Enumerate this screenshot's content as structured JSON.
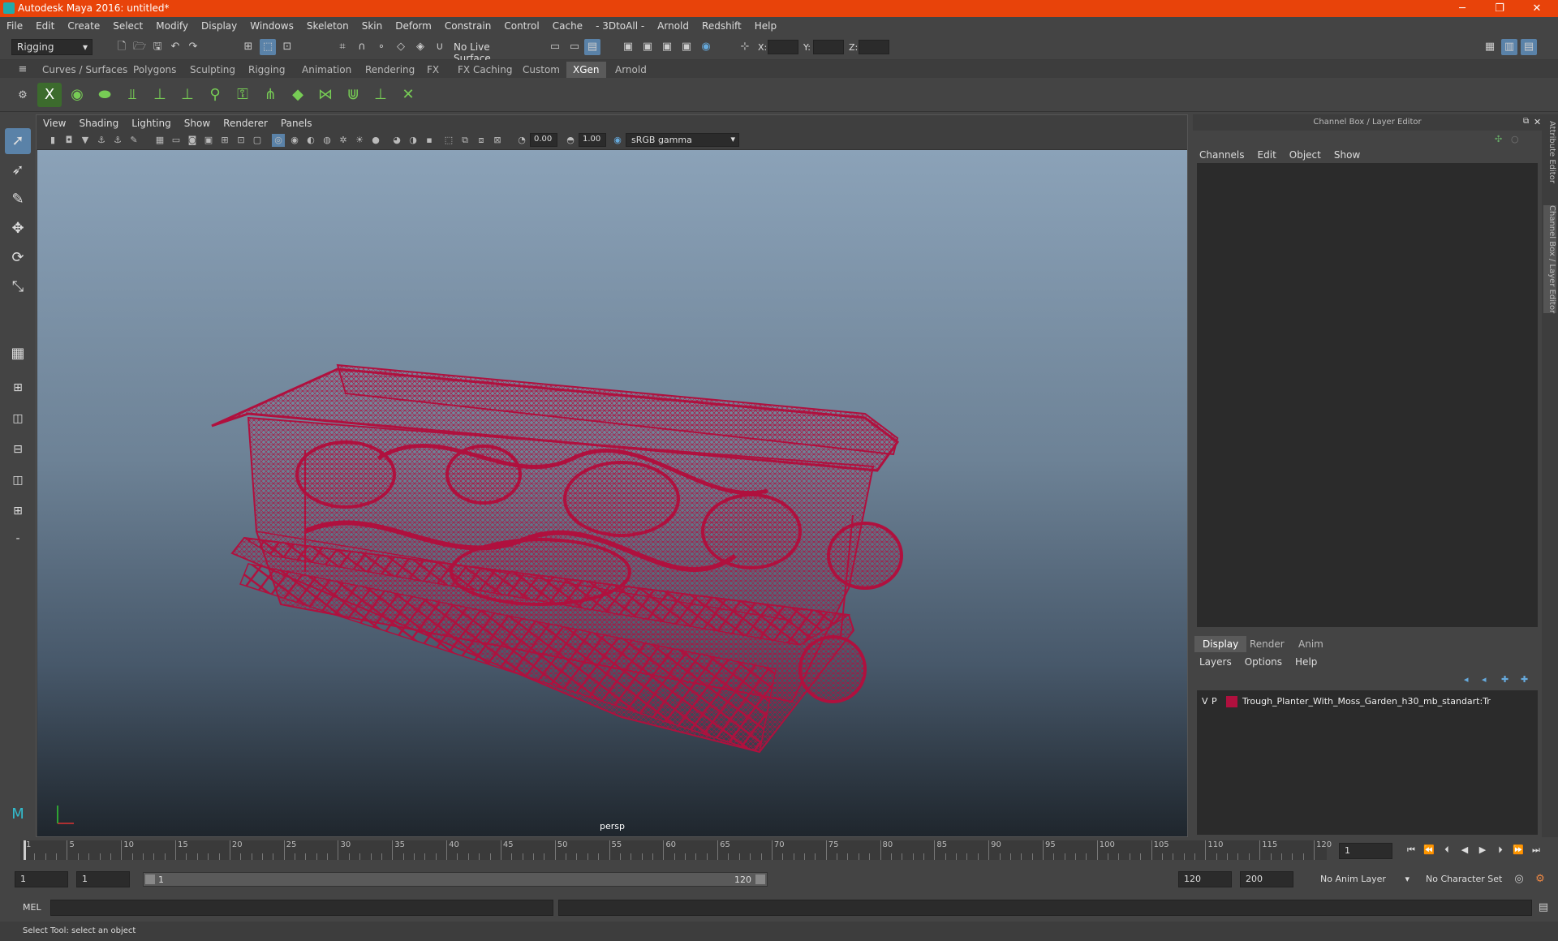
{
  "window": {
    "title": "Autodesk Maya 2016: untitled*",
    "minimize": "─",
    "maximize": "❐",
    "close": "✕"
  },
  "menus": [
    "File",
    "Edit",
    "Create",
    "Select",
    "Modify",
    "Display",
    "Windows",
    "Skeleton",
    "Skin",
    "Deform",
    "Constrain",
    "Control",
    "Cache",
    "- 3DtoAll -",
    "Arnold",
    "Redshift",
    "Help"
  ],
  "status_line": {
    "mode": "Rigging",
    "live_surface": "No Live Surface",
    "x_label": "X:",
    "y_label": "Y:",
    "z_label": "Z:"
  },
  "shelf_tabs": [
    "Curves / Surfaces",
    "Polygons",
    "Sculpting",
    "Rigging",
    "Animation",
    "Rendering",
    "FX",
    "FX Caching",
    "Custom",
    "XGen",
    "Arnold"
  ],
  "active_shelf_tab": "XGen",
  "viewport": {
    "menus": [
      "View",
      "Shading",
      "Lighting",
      "Show",
      "Renderer",
      "Panels"
    ],
    "exposure": "0.00",
    "gamma": "1.00",
    "color_space": "sRGB gamma",
    "camera_label": "persp",
    "wire_color": "#b0103e"
  },
  "channel_box": {
    "title": "Channel Box / Layer Editor",
    "menus": [
      "Channels",
      "Edit",
      "Object",
      "Show"
    ]
  },
  "layer_editor": {
    "tabs": [
      "Display",
      "Render",
      "Anim"
    ],
    "active_tab": "Display",
    "menus": [
      "Layers",
      "Options",
      "Help"
    ],
    "layers": [
      {
        "v": "V",
        "p": "P",
        "color": "#b0103e",
        "name": "Trough_Planter_With_Moss_Garden_h30_mb_standart:Tr"
      }
    ]
  },
  "side_tabs": [
    "Attribute Editor",
    "Channel Box / Layer Editor"
  ],
  "timeline": {
    "ticks": [
      "1",
      "5",
      "10",
      "15",
      "20",
      "25",
      "30",
      "35",
      "40",
      "45",
      "50",
      "55",
      "60",
      "65",
      "70",
      "75",
      "80",
      "85",
      "90",
      "95",
      "100",
      "105",
      "110",
      "115",
      "120"
    ],
    "current_frame": "1"
  },
  "range_slider": {
    "start": "1",
    "playback_start": "1",
    "range_start_label": "1",
    "range_end_label": "120",
    "playback_end": "120",
    "end": "200",
    "anim_layer": "No Anim Layer",
    "character_set": "No Character Set"
  },
  "command_line": {
    "label": "MEL"
  },
  "help_line": {
    "text": "Select Tool: select an object"
  }
}
